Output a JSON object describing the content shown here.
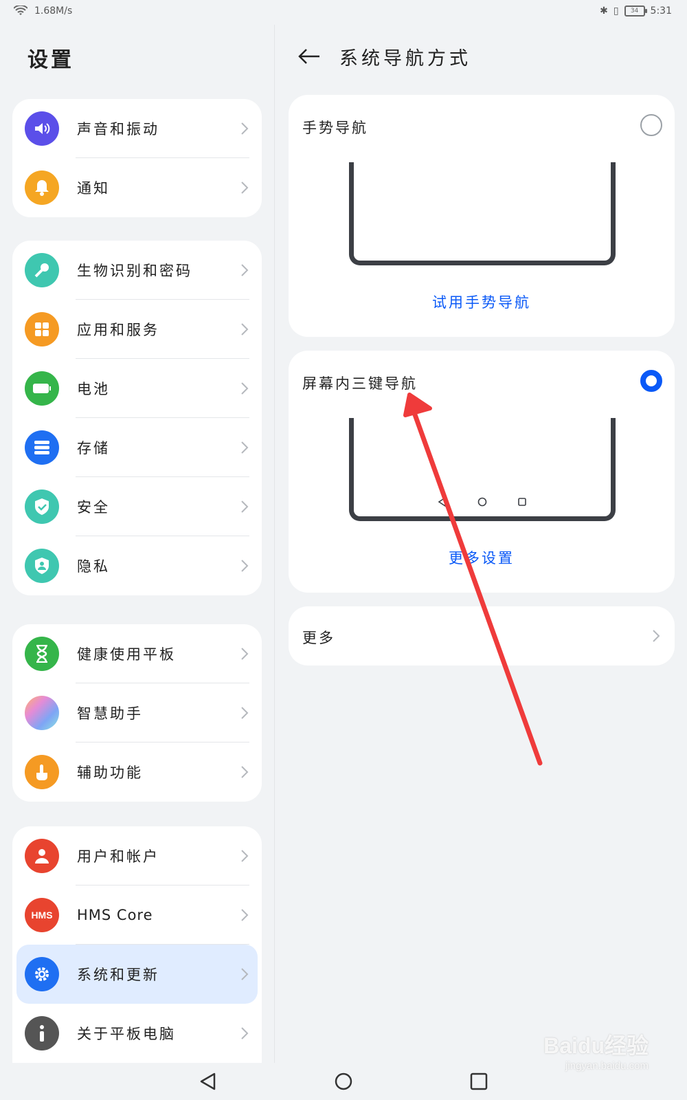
{
  "status_bar": {
    "speed": "1.68M/s",
    "battery": "34",
    "time": "5:31"
  },
  "left_pane": {
    "title": "设置",
    "groups": [
      [
        {
          "label": "声音和振动",
          "icon": "sound-icon",
          "color": "#5b4fe9"
        },
        {
          "label": "通知",
          "icon": "bell-icon",
          "color": "#f5a623"
        }
      ],
      [
        {
          "label": "生物识别和密码",
          "icon": "key-icon",
          "color": "#3fc7b0"
        },
        {
          "label": "应用和服务",
          "icon": "apps-icon",
          "color": "#f59a23"
        },
        {
          "label": "电池",
          "icon": "battery-icon",
          "color": "#35b54a"
        },
        {
          "label": "存储",
          "icon": "storage-icon",
          "color": "#1f6ff2"
        },
        {
          "label": "安全",
          "icon": "shield-check-icon",
          "color": "#3fc7b0"
        },
        {
          "label": "隐私",
          "icon": "privacy-shield-icon",
          "color": "#3fc7b0"
        }
      ],
      [
        {
          "label": "健康使用平板",
          "icon": "hourglass-icon",
          "color": "#35b54a"
        },
        {
          "label": "智慧助手",
          "icon": "assistant-icon",
          "color": "#c9a6f0"
        },
        {
          "label": "辅助功能",
          "icon": "hand-icon",
          "color": "#f59a23"
        }
      ],
      [
        {
          "label": "用户和帐户",
          "icon": "user-icon",
          "color": "#e8442f"
        },
        {
          "label": "HMS Core",
          "icon": "hms-icon",
          "color": "#e8442f",
          "badge": "HMS"
        },
        {
          "label": "系统和更新",
          "icon": "gear-icon",
          "color": "#1f6ff2",
          "active": true
        },
        {
          "label": "关于平板电脑",
          "icon": "info-icon",
          "color": "#555555"
        }
      ]
    ]
  },
  "right_pane": {
    "title": "系统导航方式",
    "gesture": {
      "title": "手势导航",
      "selected": false,
      "link": "试用手势导航"
    },
    "three_key": {
      "title": "屏幕内三键导航",
      "selected": true,
      "link": "更多设置"
    },
    "more": {
      "label": "更多"
    }
  },
  "colors": {
    "accent": "#0a59f7",
    "annotation_arrow": "#ef3b3b"
  },
  "watermark": {
    "main": "Baidu经验",
    "sub": "jingyan.baidu.com"
  }
}
